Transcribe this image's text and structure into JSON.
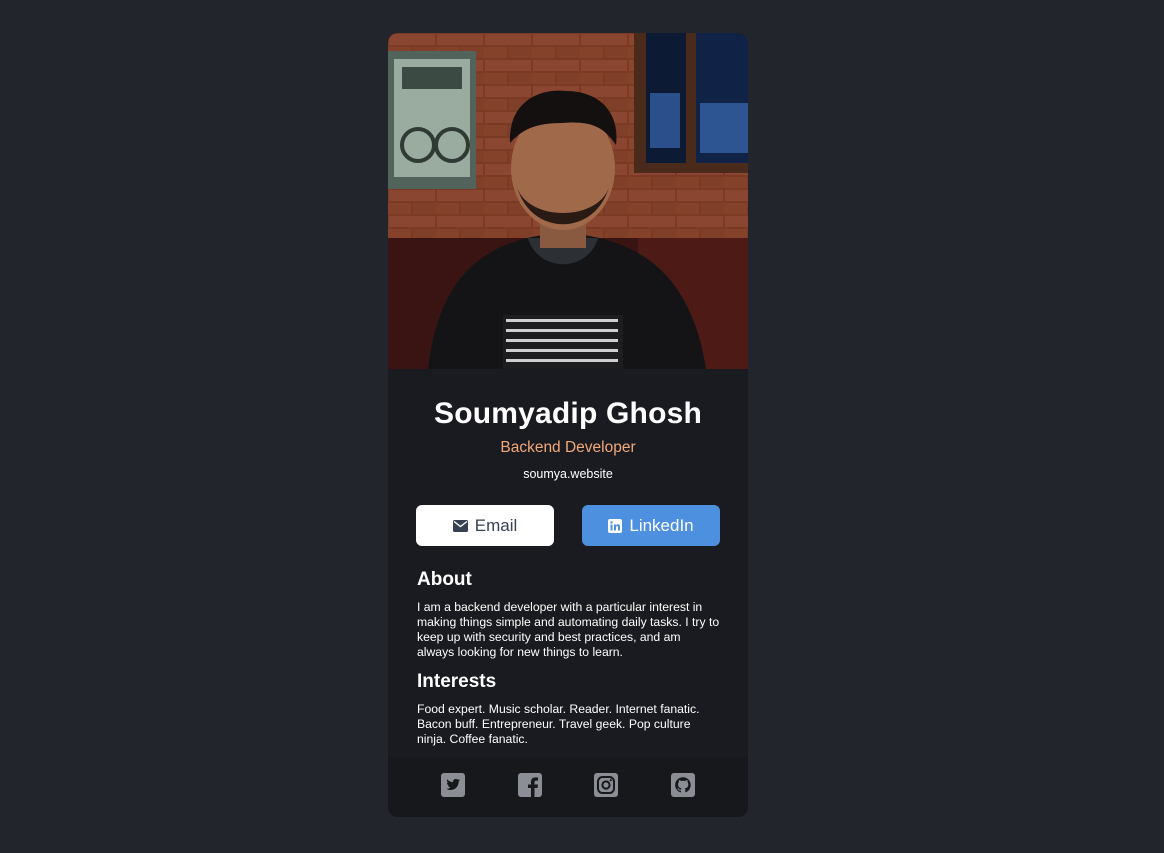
{
  "profile": {
    "name": "Soumyadip Ghosh",
    "role": "Backend Developer",
    "website": "soumya.website",
    "photo_alt": "Profile photo"
  },
  "buttons": {
    "email_label": "Email",
    "linkedin_label": "LinkedIn"
  },
  "about": {
    "title": "About",
    "text": "I am a backend developer with a particular interest in making things simple and automating daily tasks. I try to keep up with security and best practices, and am always looking for new things to learn."
  },
  "interests": {
    "title": "Interests",
    "text": "Food expert. Music scholar. Reader. Internet fanatic. Bacon buff. Entrepreneur. Travel geek. Pop culture ninja. Coffee fanatic."
  },
  "social": [
    {
      "icon": "twitter-icon"
    },
    {
      "icon": "facebook-icon"
    },
    {
      "icon": "instagram-icon"
    },
    {
      "icon": "github-icon"
    }
  ],
  "colors": {
    "page_bg": "#23252c",
    "card_bg": "#1a1b20",
    "footer_bg": "#17181c",
    "accent": "#f2a97a",
    "linkedin": "#4e90e0",
    "social_icon": "#8c8e96"
  }
}
